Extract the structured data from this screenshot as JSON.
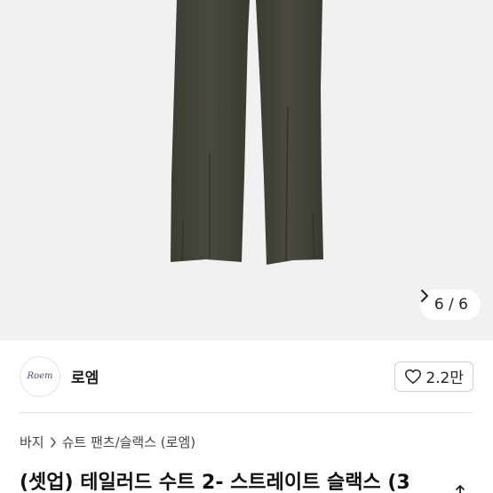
{
  "gallery": {
    "counter_text": "6 / 6",
    "background_color": "#f1f1f1",
    "product_color": "#45443a"
  },
  "shop": {
    "logo_text": "Roem",
    "name": "로엠",
    "like_count": "2.2만"
  },
  "breadcrumb": {
    "items": [
      "바지",
      "슈트 팬츠/슬랙스 (로엠)"
    ]
  },
  "product": {
    "title": "(셋업) 테일러드 수트 2- 스트레이트 슬랙스 (3"
  },
  "icons": {
    "next": "chevron-right-icon",
    "like": "heart-icon",
    "breadcrumb_separator": "chevron-right-icon",
    "share": "share-icon"
  }
}
